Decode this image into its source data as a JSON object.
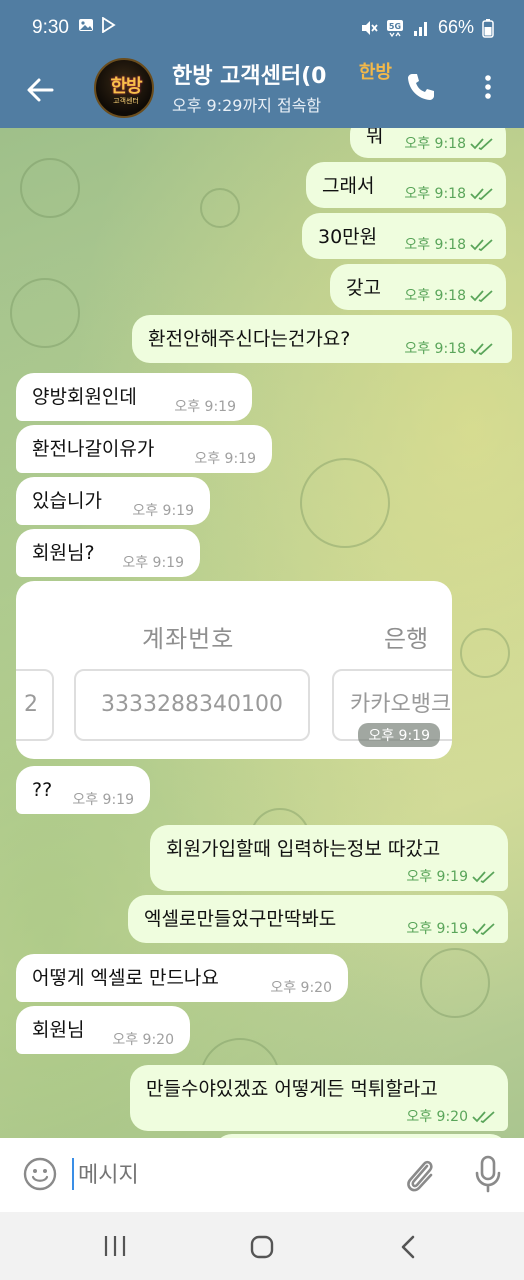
{
  "status_bar": {
    "time": "9:30",
    "battery": "66%",
    "network": "5G",
    "left_icons": [
      "image-icon",
      "play-store-icon"
    ],
    "right_icons": [
      "mute-icon",
      "network-5g-icon",
      "signal-icon",
      "battery-icon"
    ]
  },
  "header": {
    "title": "한방 고객센터(0",
    "title_badge": "한방",
    "subtitle": "오후 9:29까지 접속함",
    "avatar_logo": "한방",
    "avatar_sub": "고객센터"
  },
  "messages": [
    {
      "dir": "out",
      "text": "뭐",
      "time": "오후 9:18",
      "read": true
    },
    {
      "dir": "out",
      "text": "그래서",
      "time": "오후 9:18",
      "read": true
    },
    {
      "dir": "out",
      "text": "30만원",
      "time": "오후 9:18",
      "read": true
    },
    {
      "dir": "out",
      "text": "갖고",
      "time": "오후 9:18",
      "read": true
    },
    {
      "dir": "out",
      "text": "환전안해주신다는건가요?",
      "time": "오후 9:18",
      "read": true
    },
    {
      "dir": "in",
      "text": "양방회원인데",
      "time": "오후 9:19"
    },
    {
      "dir": "in",
      "text": "환전나갈이유가",
      "time": "오후 9:19"
    },
    {
      "dir": "in",
      "text": "있습니가",
      "time": "오후 9:19"
    },
    {
      "dir": "in",
      "text": "회원님?",
      "time": "오후 9:19"
    },
    {
      "dir": "in",
      "type": "image",
      "time": "오후 9:19",
      "image_text": {
        "header_account": "계좌번호",
        "header_bank": "은행",
        "left_fragment": "2",
        "account_number": "3333288340100",
        "bank_fragment": "카카오뱅크"
      }
    },
    {
      "dir": "in",
      "text": "??",
      "time": "오후 9:19"
    },
    {
      "dir": "out",
      "text": "회원가입할때 입력하는정보 따갔고",
      "time": "오후 9:19",
      "read": true
    },
    {
      "dir": "out",
      "text": "엑셀로만들었구만딱봐도",
      "time": "오후 9:19",
      "read": true
    },
    {
      "dir": "in",
      "text": "어떻게 엑셀로 만드나요",
      "time": "오후 9:20"
    },
    {
      "dir": "in",
      "text": "회원님",
      "time": "오후 9:20"
    },
    {
      "dir": "out",
      "text": "만들수야있겠죠 어떻게든 먹튀할라고",
      "time": "오후 9:20",
      "read": true
    }
  ],
  "input": {
    "placeholder": "메시지"
  },
  "colors": {
    "header": "#517da2",
    "outgoing_bubble": "#effdde",
    "incoming_bubble": "#ffffff",
    "read_ticks": "#5aa55a",
    "accent": "#3a8ee6"
  },
  "icons": {
    "back": "back-arrow-icon",
    "call": "phone-icon",
    "menu": "more-vertical-icon",
    "emoji": "emoji-icon",
    "attach": "paperclip-icon",
    "voice": "microphone-icon"
  }
}
